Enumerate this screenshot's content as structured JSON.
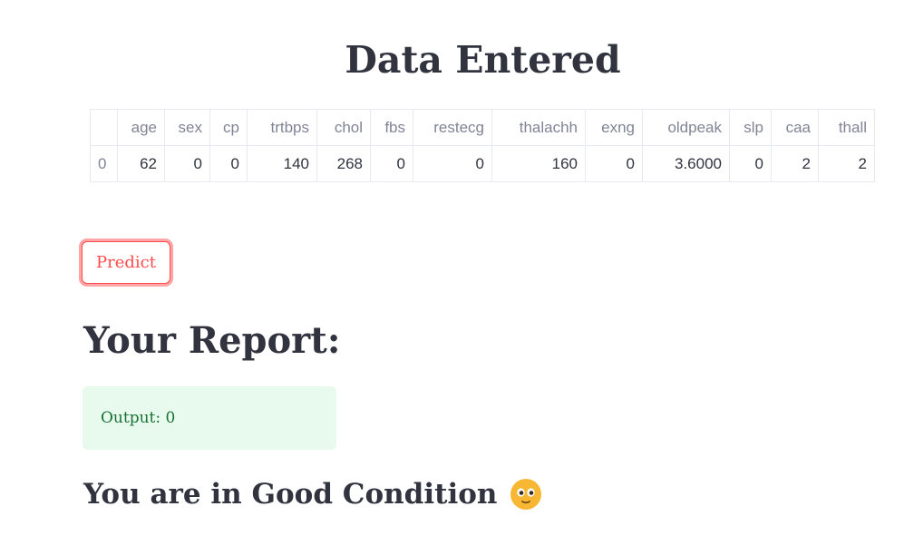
{
  "page": {
    "title": "Data Entered"
  },
  "table": {
    "columns": [
      "age",
      "sex",
      "cp",
      "trtbps",
      "chol",
      "fbs",
      "restecg",
      "thalachh",
      "exng",
      "oldpeak",
      "slp",
      "caa",
      "thall"
    ],
    "rows": [
      {
        "index": "0",
        "values": [
          "62",
          "0",
          "0",
          "140",
          "268",
          "0",
          "0",
          "160",
          "0",
          "3.6000",
          "0",
          "2",
          "2"
        ]
      }
    ]
  },
  "predict_button": {
    "label": "Predict"
  },
  "report": {
    "heading": "Your Report:",
    "output_text": "Output: 0",
    "condition_text": "You are in Good Condition",
    "condition_icon": "smiling-face-emoji"
  },
  "colors": {
    "text": "#31333f",
    "muted": "#808495",
    "accent": "#ff4b4b",
    "success_bg": "#e8f9ee",
    "success_text": "#177233",
    "emoji_face": "#f7b733"
  }
}
